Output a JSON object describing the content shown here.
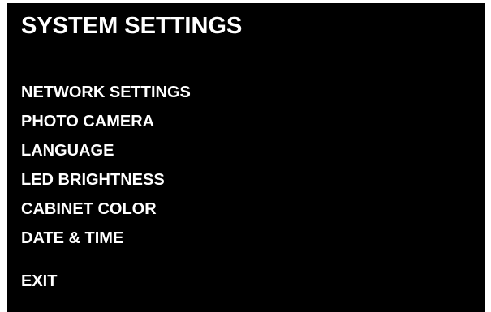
{
  "screen": {
    "title": "SYSTEM SETTINGS",
    "menu_items": [
      {
        "label": "NETWORK SETTINGS"
      },
      {
        "label": "PHOTO CAMERA"
      },
      {
        "label": "LANGUAGE"
      },
      {
        "label": "LED BRIGHTNESS"
      },
      {
        "label": "CABINET COLOR"
      },
      {
        "label": "DATE & TIME"
      }
    ],
    "exit_label": "EXIT"
  },
  "colors": {
    "background": "#000000",
    "text": "#ffffff",
    "page": "#ffffff"
  }
}
